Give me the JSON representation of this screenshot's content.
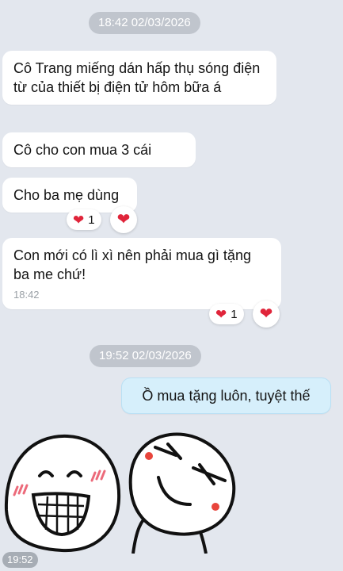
{
  "timestamps": [
    "18:42 02/03/2026",
    "19:52 02/03/2026"
  ],
  "messages": [
    {
      "text": "Cô Trang miếng dán hấp thụ sóng điện từ của thiết bị điện tử hôm bữa á"
    },
    {
      "text": "Cô cho con mua 3 cái"
    },
    {
      "text": "Cho ba mẹ dùng",
      "reaction_icon": "heart-icon",
      "reaction_count": "1"
    },
    {
      "text": "Con mới có lì xì nên phải mua gì tặng ba me chứ!",
      "time": "18:42",
      "reaction_icon": "heart-icon",
      "reaction_count": "1"
    },
    {
      "text": "Ồ mua tặng luôn, tuyệt thế",
      "outgoing": true
    }
  ],
  "sticker": {
    "time": "19:52"
  },
  "icons": {
    "heart": "❤"
  },
  "colors": {
    "background": "#e3e7ee",
    "outgoing_bubble": "#d6effb",
    "heart": "#e0243a",
    "timestamp_pill": "#c0c5cd"
  }
}
